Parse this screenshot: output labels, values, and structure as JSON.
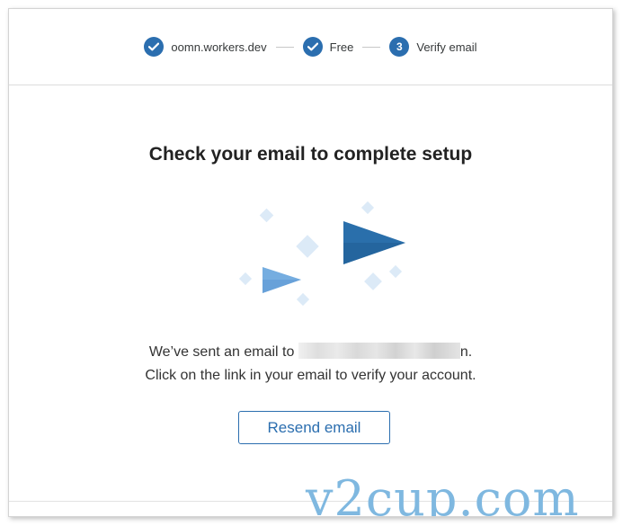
{
  "stepper": {
    "steps": [
      {
        "label": "oomn.workers.dev",
        "state": "complete"
      },
      {
        "label": "Free",
        "state": "complete"
      },
      {
        "label": "Verify email",
        "state": "current",
        "number": "3"
      }
    ]
  },
  "main": {
    "title": "Check your email to complete setup",
    "message_prefix": "We’ve sent an email to",
    "message_suffix": "n.",
    "message_line2": "Click on the link in your email to verify your account.",
    "resend_label": "Resend email"
  },
  "watermark": "v2cup.com",
  "colors": {
    "accent": "#2b6eaf",
    "plane_large": "#2a6fab",
    "plane_small": "#75ade0",
    "sparkle": "#dceaf7"
  },
  "icons": {
    "step_complete": "check-icon",
    "illustration": "paper-plane-icon"
  }
}
